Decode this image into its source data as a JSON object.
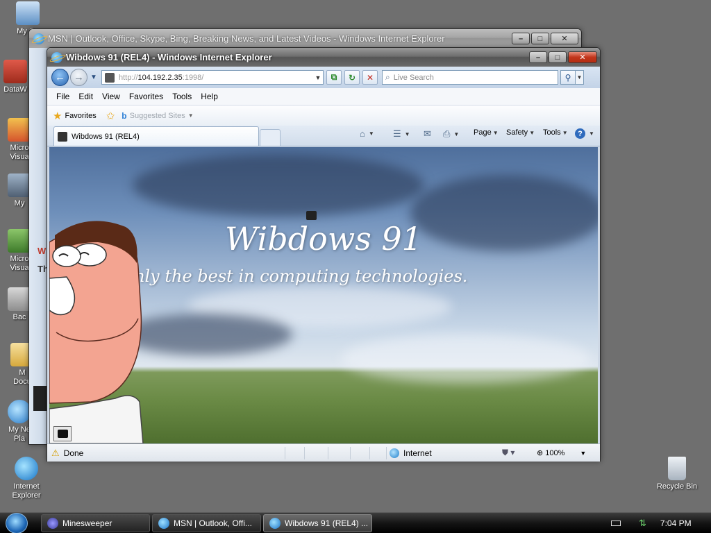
{
  "desktop": {
    "icons": [
      {
        "label": "My Co",
        "name": "my-computer"
      },
      {
        "label": "DataW",
        "name": "dataw"
      },
      {
        "label": "Micro\nVisua",
        "name": "microsoft-visual-1"
      },
      {
        "label": "My",
        "name": "my"
      },
      {
        "label": "Micro\nVisua",
        "name": "microsoft-visual-2"
      },
      {
        "label": "Bac",
        "name": "backup"
      },
      {
        "label": "M\nDocu",
        "name": "my-documents"
      },
      {
        "label": "My Ne\nPla",
        "name": "my-network-places"
      },
      {
        "label": "Internet\nExplorer",
        "name": "internet-explorer"
      },
      {
        "label": "Recycle Bin",
        "name": "recycle-bin"
      }
    ]
  },
  "back_window": {
    "title": "MSN | Outlook, Office, Skype, Bing, Breaking News, and Latest Videos - Windows Internet Explorer",
    "fragment_red": "W",
    "fragment_dark": "Th"
  },
  "front_window": {
    "title": "Wibdows 91 (REL4) - Windows Internet Explorer",
    "address_prefix": "http://",
    "address_host": "104.192.2.35",
    "address_suffix": ":1998/",
    "search_placeholder": "Live Search",
    "menu": [
      "File",
      "Edit",
      "View",
      "Favorites",
      "Tools",
      "Help"
    ],
    "favorites_label": "Favorites",
    "suggested_sites": "Suggested Sites",
    "tab_title": "Wibdows 91 (REL4)",
    "commands": {
      "page": "Page",
      "safety": "Safety",
      "tools": "Tools"
    },
    "content": {
      "heading": "Wibdows 91",
      "tagline": "only the best in computing technologies."
    },
    "status": {
      "text": "Done",
      "zone": "Internet",
      "zoom": "100%"
    }
  },
  "taskbar": {
    "buttons": [
      {
        "label": "Minesweeper",
        "active": false
      },
      {
        "label": "MSN | Outlook, Offi...",
        "active": false
      },
      {
        "label": "Wibdows 91 (REL4) ...",
        "active": true
      }
    ],
    "clock": "7:04 PM"
  },
  "colors": {
    "accent": "#2a65b0",
    "close_button": "#c2351b",
    "desktop": "#6f6f6f"
  }
}
